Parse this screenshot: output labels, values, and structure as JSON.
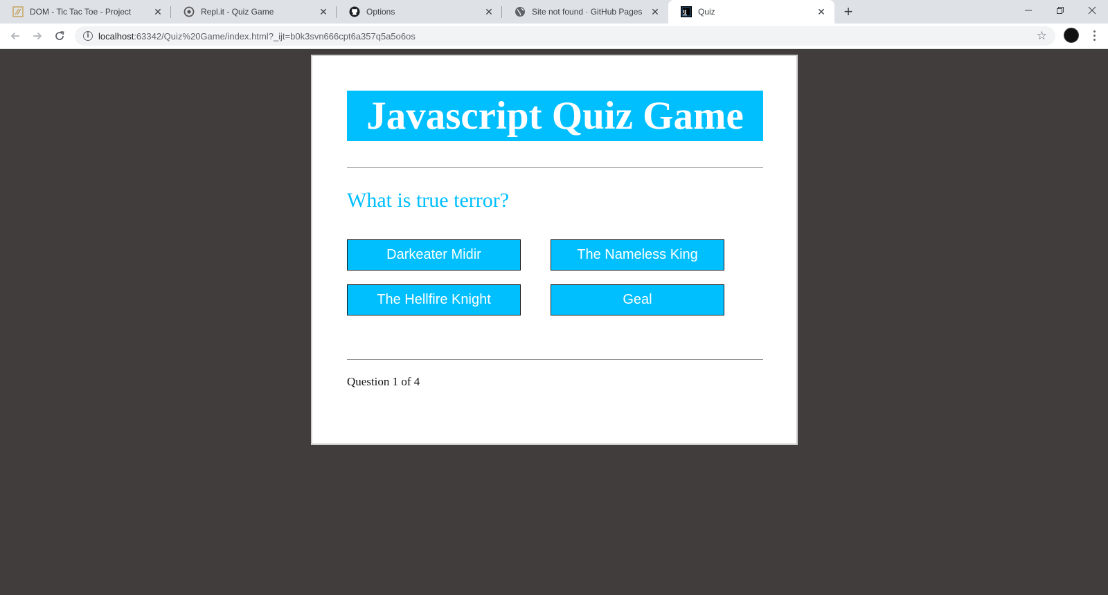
{
  "browser": {
    "tabs": [
      {
        "title": "DOM - Tic Tac Toe - Project",
        "icon": "theodinproject-icon"
      },
      {
        "title": "Repl.it - Quiz Game",
        "icon": "replit-icon"
      },
      {
        "title": "Options",
        "icon": "github-icon"
      },
      {
        "title": "Site not found · GitHub Pages",
        "icon": "globe-icon"
      },
      {
        "title": "Quiz",
        "icon": "intellij-icon"
      }
    ],
    "active_tab": 4,
    "url_host": "localhost",
    "url_rest": ":63342/Quiz%20Game/index.html?_ijt=b0k3svn666cpt6a357q5a5o6os"
  },
  "quiz": {
    "title": "Javascript Quiz Game",
    "question": "What is true terror?",
    "choices": [
      "Darkeater Midir",
      "The Nameless King",
      "The Hellfire Knight",
      "Geal"
    ],
    "progress": "Question 1 of 4"
  },
  "colors": {
    "accent": "#00bfff",
    "page_background": "#403d3c"
  }
}
